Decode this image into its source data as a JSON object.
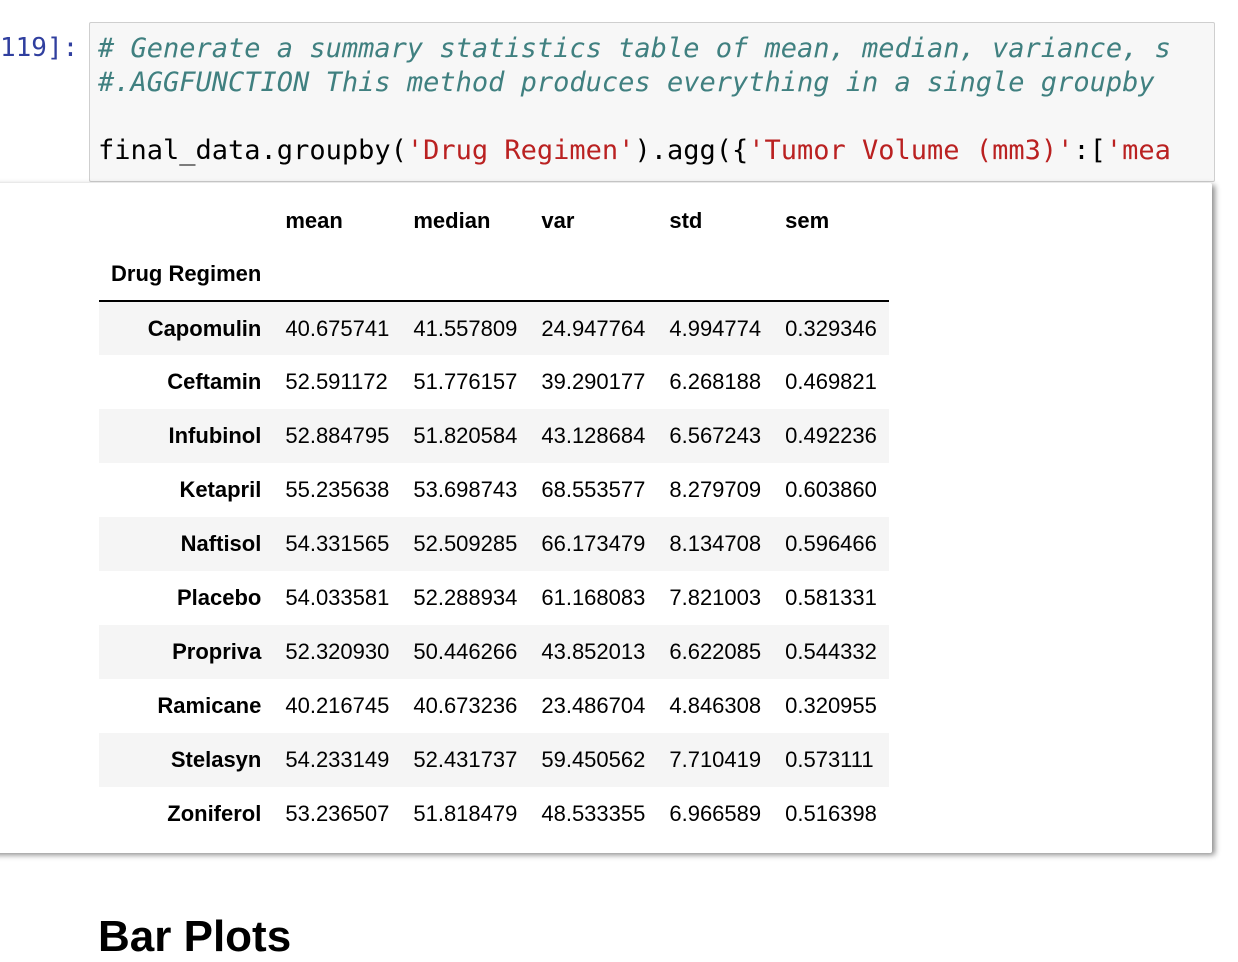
{
  "cell": {
    "prompt": "119]:",
    "code_lines": [
      {
        "type": "comment",
        "text": "# Generate a summary statistics table of mean, median, variance, s"
      },
      {
        "type": "comment",
        "text": "#.AGGFUNCTION This method produces everything in a single groupby"
      },
      {
        "type": "code",
        "parts": {
          "pre": "final_data.groupby(",
          "s1": "'Drug Regimen'",
          "mid": ").agg({",
          "s2": "'Tumor Volume (mm3)'",
          "post": ":[",
          "s3": "'mea"
        }
      }
    ]
  },
  "output": {
    "columns": [
      "mean",
      "median",
      "var",
      "std",
      "sem"
    ],
    "index_name": "Drug Regimen",
    "rows": [
      {
        "label": "Capomulin",
        "values": [
          "40.675741",
          "41.557809",
          "24.947764",
          "4.994774",
          "0.329346"
        ]
      },
      {
        "label": "Ceftamin",
        "values": [
          "52.591172",
          "51.776157",
          "39.290177",
          "6.268188",
          "0.469821"
        ]
      },
      {
        "label": "Infubinol",
        "values": [
          "52.884795",
          "51.820584",
          "43.128684",
          "6.567243",
          "0.492236"
        ]
      },
      {
        "label": "Ketapril",
        "values": [
          "55.235638",
          "53.698743",
          "68.553577",
          "8.279709",
          "0.603860"
        ]
      },
      {
        "label": "Naftisol",
        "values": [
          "54.331565",
          "52.509285",
          "66.173479",
          "8.134708",
          "0.596466"
        ]
      },
      {
        "label": "Placebo",
        "values": [
          "54.033581",
          "52.288934",
          "61.168083",
          "7.821003",
          "0.581331"
        ]
      },
      {
        "label": "Propriva",
        "values": [
          "52.320930",
          "50.446266",
          "43.852013",
          "6.622085",
          "0.544332"
        ]
      },
      {
        "label": "Ramicane",
        "values": [
          "40.216745",
          "40.673236",
          "23.486704",
          "4.846308",
          "0.320955"
        ]
      },
      {
        "label": "Stelasyn",
        "values": [
          "54.233149",
          "52.431737",
          "59.450562",
          "7.710419",
          "0.573111"
        ]
      },
      {
        "label": "Zoniferol",
        "values": [
          "53.236507",
          "51.818479",
          "48.533355",
          "6.966589",
          "0.516398"
        ]
      }
    ]
  },
  "next_heading": "Bar Plots"
}
